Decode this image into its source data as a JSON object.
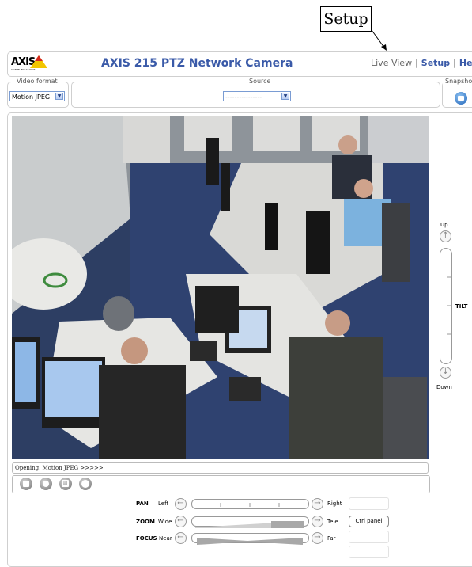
{
  "annotation": {
    "label": "Setup"
  },
  "header": {
    "logo_text": "AXIS",
    "logo_sub": "COMMUNICATIONS",
    "title": "AXIS 215 PTZ Network Camera",
    "nav": {
      "live_view": "Live View",
      "setup": "Setup",
      "help": "Help"
    }
  },
  "toolbar": {
    "video_format": {
      "title": "Video format",
      "value": "Motion JPEG"
    },
    "source": {
      "title": "Source",
      "value": "----------------"
    },
    "snapshot": {
      "title": "Snapshot"
    }
  },
  "stream": {
    "status": "Opening, Motion JPEG >>>>>"
  },
  "ptz": {
    "pan": {
      "label": "PAN",
      "left": "Left",
      "right": "Right"
    },
    "zoom": {
      "label": "ZOOM",
      "left": "Wide",
      "right": "Tele"
    },
    "focus": {
      "label": "FOCUS",
      "left": "Near",
      "right": "Far"
    },
    "ctrl_panel": "Ctrl panel",
    "tilt": {
      "up": "Up",
      "label": "TILT",
      "down": "Down"
    }
  },
  "colors": {
    "brand_blue": "#3a5aa8",
    "logo_yellow": "#f2c500",
    "logo_red": "#d62a1e"
  }
}
